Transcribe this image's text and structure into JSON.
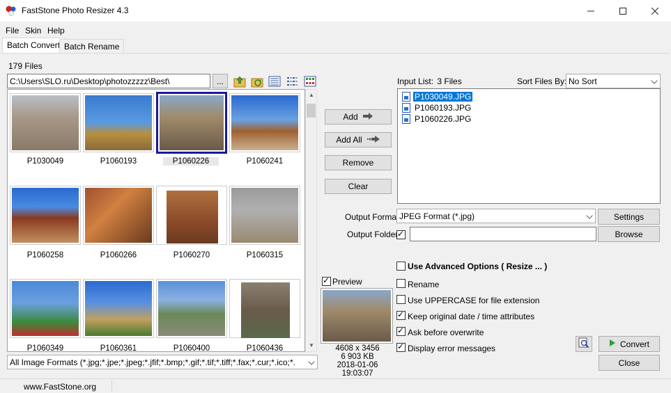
{
  "window": {
    "title": "FastStone Photo Resizer 4.3"
  },
  "menu": [
    "File",
    "Skin",
    "Help"
  ],
  "tabs": [
    "Batch Convert",
    "Batch Rename"
  ],
  "file_count": "179 Files",
  "path": "C:\\Users\\SLO.ru\\Desktop\\photozzzzz\\Best\\",
  "browse_dots": "...",
  "thumbnails": [
    {
      "name": "P1030049"
    },
    {
      "name": "P1060193"
    },
    {
      "name": "P1060226"
    },
    {
      "name": "P1060241"
    },
    {
      "name": "P1060258"
    },
    {
      "name": "P1060266"
    },
    {
      "name": "P1060270"
    },
    {
      "name": "P1060315"
    },
    {
      "name": "P1060349"
    },
    {
      "name": "P1060361"
    },
    {
      "name": "P1060400"
    },
    {
      "name": "P1060436"
    }
  ],
  "format_filter": "All Image Formats (*.jpg;*.jpe;*.jpeg;*.jfif;*.bmp;*.gif;*.tif;*.tiff;*.fax;*.cur;*.ico;*.",
  "buttons": {
    "add": "Add",
    "add_all": "Add All",
    "remove": "Remove",
    "clear": "Clear",
    "settings": "Settings",
    "browse": "Browse",
    "convert": "Convert",
    "close": "Close"
  },
  "input_list": {
    "label": "Input List:",
    "count": "3 Files",
    "sort_label": "Sort Files By:",
    "sort_value": "No Sort",
    "items": [
      "P1030049.JPG",
      "P1060193.JPG",
      "P1060226.JPG"
    ]
  },
  "output": {
    "format_label": "Output Format:",
    "format_value": "JPEG Format (*.jpg)",
    "folder_label": "Output Folder:",
    "folder_value": ""
  },
  "preview": {
    "label": "Preview",
    "dimensions": "4608 x 3456",
    "size": "6 903 KB",
    "date": "2018-01-06 19:03:07"
  },
  "options": [
    {
      "label": "Use Advanced Options ( Resize ... )",
      "checked": false,
      "bold": true
    },
    {
      "label": "Rename",
      "checked": false
    },
    {
      "label": "Use UPPERCASE for file extension",
      "checked": false
    },
    {
      "label": "Keep original date / time attributes",
      "checked": true
    },
    {
      "label": "Ask before overwrite",
      "checked": true
    },
    {
      "label": "Display error messages",
      "checked": true
    }
  ],
  "status": "www.FastStone.org"
}
